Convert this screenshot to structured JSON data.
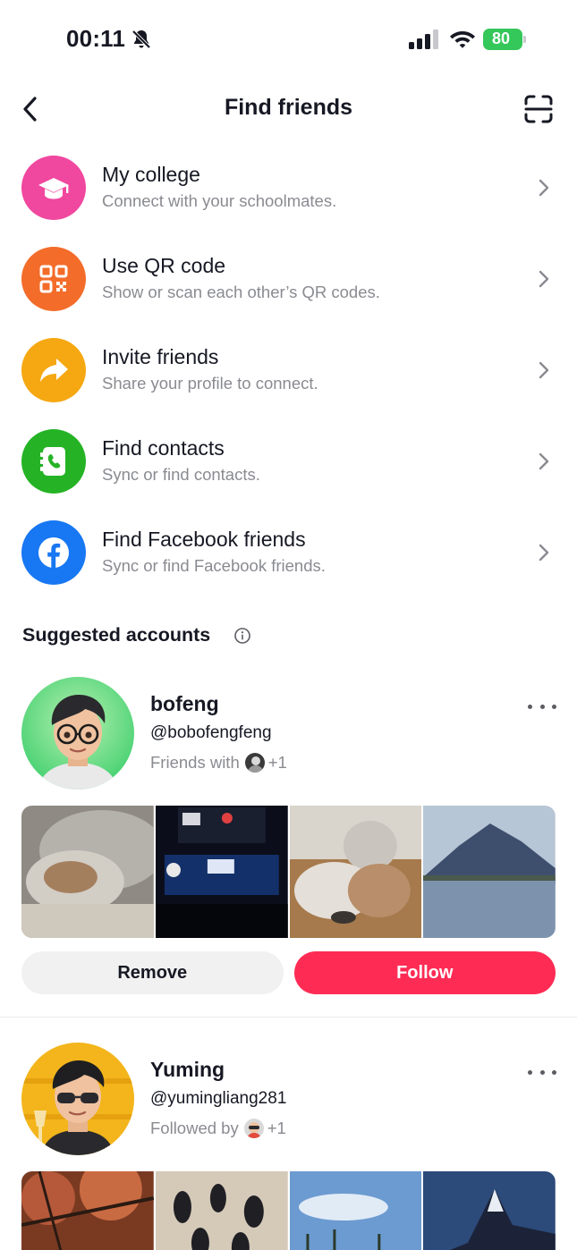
{
  "status_bar": {
    "time": "00:11",
    "battery": "80",
    "icons": [
      "bell-slash-icon",
      "cellular-signal-icon",
      "wifi-icon",
      "battery-charging-icon"
    ]
  },
  "header": {
    "title": "Find friends",
    "back_icon": "chevron-left-icon",
    "scan_icon": "scan-icon"
  },
  "options": [
    {
      "title": "My college",
      "subtitle": "Connect with your schoolmates.",
      "icon": "graduation-cap-icon",
      "color": "#f0479f"
    },
    {
      "title": "Use QR code",
      "subtitle": "Show or scan each other’s QR codes.",
      "icon": "qr-code-icon",
      "color": "#f36c2a"
    },
    {
      "title": "Invite friends",
      "subtitle": "Share your profile to connect.",
      "icon": "share-arrow-icon",
      "color": "#f5a811"
    },
    {
      "title": "Find contacts",
      "subtitle": "Sync or find contacts.",
      "icon": "contacts-phone-icon",
      "color": "#25b325"
    },
    {
      "title": "Find Facebook friends",
      "subtitle": "Sync or find Facebook friends.",
      "icon": "facebook-icon",
      "color": "#1877f2"
    }
  ],
  "suggested": {
    "title": "Suggested accounts",
    "accounts": [
      {
        "name": "bofeng",
        "handle": "@bobofengfeng",
        "mutual_label": "Friends with",
        "mutual_extra": "+1",
        "remove_label": "Remove",
        "follow_label": "Follow"
      },
      {
        "name": "Yuming",
        "handle": "@yumingliang281",
        "mutual_label": "Followed by",
        "mutual_extra": "+1"
      }
    ]
  },
  "colors": {
    "follow": "#fe2c55",
    "secondary_text": "#8a8b91"
  }
}
